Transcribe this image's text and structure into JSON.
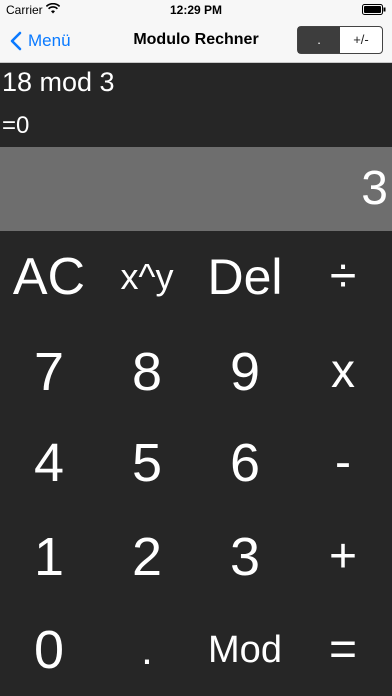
{
  "status": {
    "carrier": "Carrier",
    "time": "12:29 PM"
  },
  "nav": {
    "back_label": "Menü",
    "title": "Modulo Rechner",
    "segment_left": ".",
    "segment_right": "+/-"
  },
  "calc": {
    "expression": "18 mod 3",
    "result": "=0",
    "display": "3"
  },
  "keys": {
    "ac": "AC",
    "power": "x^y",
    "del": "Del",
    "divide": "÷",
    "k7": "7",
    "k8": "8",
    "k9": "9",
    "multiply": "x",
    "k4": "4",
    "k5": "5",
    "k6": "6",
    "minus": "-",
    "k1": "1",
    "k2": "2",
    "k3": "3",
    "plus": "+",
    "k0": "0",
    "dot": ".",
    "mod": "Mod",
    "equals": "="
  },
  "colors": {
    "accent": "#0a7aff",
    "background": "#262626",
    "display": "#6e6e6e"
  }
}
